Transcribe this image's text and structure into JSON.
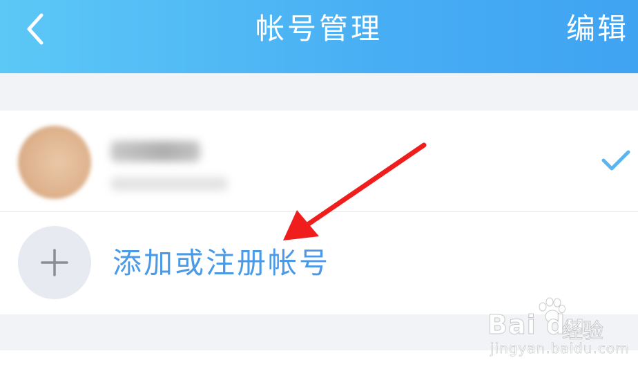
{
  "header": {
    "title": "帐号管理",
    "edit_label": "编辑",
    "back_icon": "chevron-left-icon"
  },
  "accounts": [
    {
      "avatar": "blurred-avatar",
      "name": "",
      "selected": true,
      "check_icon": "checkmark-icon"
    }
  ],
  "add_account": {
    "label": "添加或注册帐号",
    "icon": "plus-icon"
  },
  "watermark": {
    "brand": "Bai du",
    "product": "经验",
    "url": "jingyan.baidu.com"
  },
  "colors": {
    "header_gradient_start": "#5cc8f6",
    "header_gradient_end": "#3fa3f2",
    "accent_blue": "#4a9ae8",
    "check_blue": "#5bb3f0",
    "annotation_arrow": "#f01d1d",
    "page_background": "#f2f3f7"
  }
}
